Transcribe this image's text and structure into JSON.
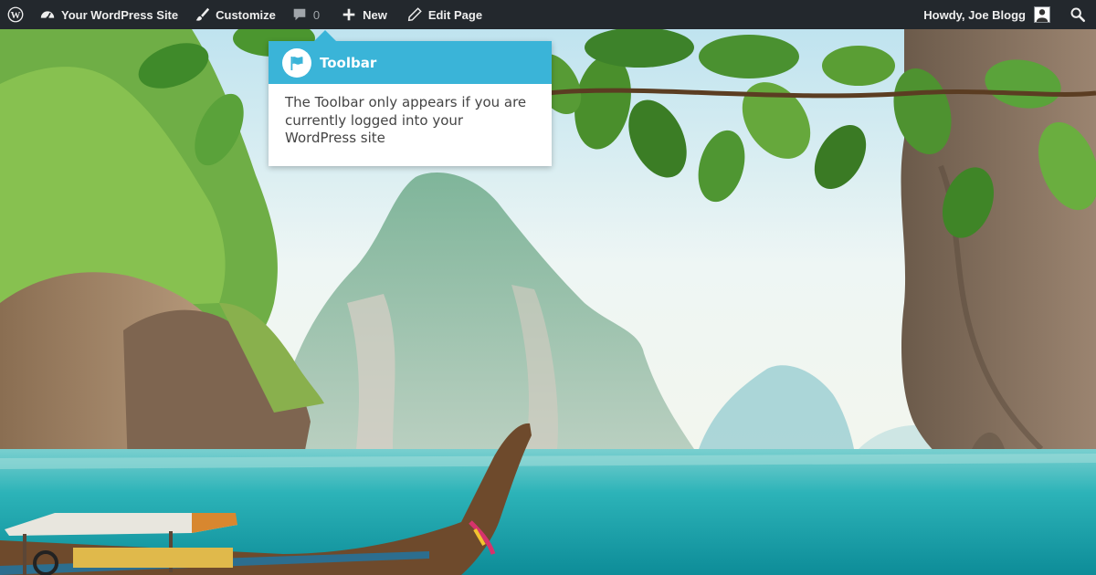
{
  "toolbar": {
    "site_name": "Your WordPress Site",
    "customize_label": "Customize",
    "comments_count": "0",
    "new_label": "New",
    "edit_label": "Edit Page",
    "greeting": "Howdy, Joe Blogg"
  },
  "pointer": {
    "title": "Toolbar",
    "body": "The Toolbar only appears if you are currently logged into your WordPress site"
  },
  "icons": {
    "wordpress": "wordpress-logo-icon",
    "dashboard": "dashboard-icon",
    "customize": "paintbrush-icon",
    "comments": "comment-bubble-icon",
    "new": "plus-icon",
    "edit": "pencil-icon",
    "avatar": "user-avatar",
    "search": "search-icon",
    "flag": "flag-icon"
  },
  "colors": {
    "toolbar_bg": "#23282d",
    "toolbar_text": "#eeeeee",
    "pointer_header": "#3ab4d8",
    "pointer_text": "#444444"
  }
}
